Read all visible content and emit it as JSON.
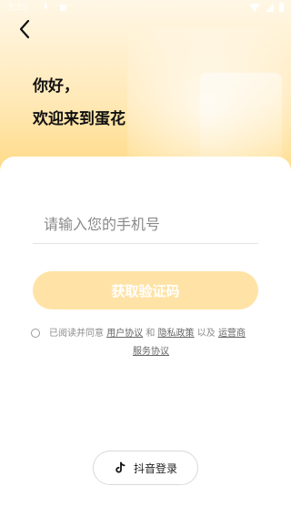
{
  "status_bar": {
    "time": "3:25",
    "download_icon": "download-icon"
  },
  "header": {
    "greeting_line1": "你好，",
    "greeting_line2": "欢迎来到蛋花"
  },
  "form": {
    "phone_placeholder": "请输入您的手机号",
    "get_code_label": "获取验证码",
    "get_code_bg": "#ffe3a6"
  },
  "agreement": {
    "prefix": "已阅读并同意",
    "user_agreement": "用户协议",
    "and": "和",
    "privacy_policy": "隐私政策",
    "and_also": "以及",
    "carrier_line1": "运营商",
    "carrier_line2": "服务协议"
  },
  "third_party": {
    "douyin_label": "抖音登录"
  }
}
